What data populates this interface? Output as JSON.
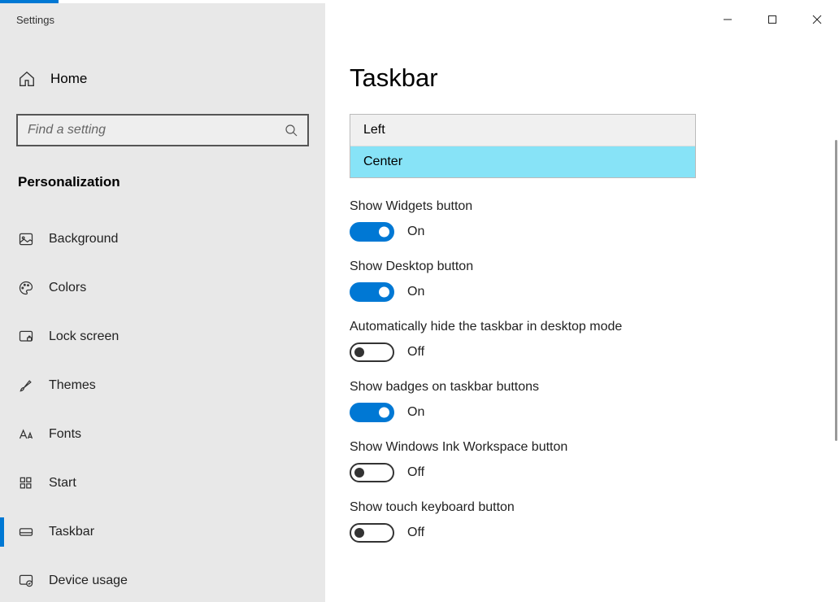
{
  "window": {
    "title": "Settings"
  },
  "sidebar": {
    "home_label": "Home",
    "search_placeholder": "Find a setting",
    "category": "Personalization",
    "items": [
      {
        "label": "Background"
      },
      {
        "label": "Colors"
      },
      {
        "label": "Lock screen"
      },
      {
        "label": "Themes"
      },
      {
        "label": "Fonts"
      },
      {
        "label": "Start"
      },
      {
        "label": "Taskbar"
      },
      {
        "label": "Device usage"
      }
    ]
  },
  "main": {
    "title": "Taskbar",
    "dropdown": {
      "options": [
        "Left",
        "Center"
      ],
      "selected": "Center"
    },
    "settings": [
      {
        "label": "Show Widgets button",
        "state": "On",
        "on": true
      },
      {
        "label": "Show Desktop button",
        "state": "On",
        "on": true
      },
      {
        "label": "Automatically hide the taskbar in desktop mode",
        "state": "Off",
        "on": false
      },
      {
        "label": "Show badges on taskbar buttons",
        "state": "On",
        "on": true
      },
      {
        "label": "Show Windows Ink Workspace button",
        "state": "Off",
        "on": false
      },
      {
        "label": "Show touch keyboard button",
        "state": "Off",
        "on": false
      }
    ]
  }
}
